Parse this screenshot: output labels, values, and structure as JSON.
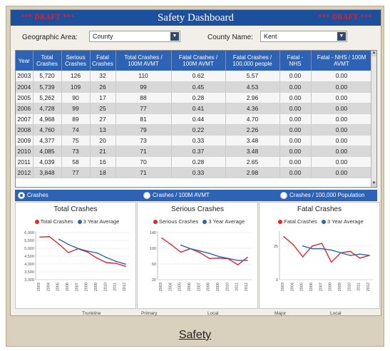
{
  "header": {
    "title": "Safety Dashboard",
    "draft_left": "*** DRAFT ***",
    "draft_right": "*** DRAFT ***"
  },
  "filters": {
    "geo_label": "Geographic Area:",
    "geo_value": "County",
    "county_label": "County Name:",
    "county_value": "Kent"
  },
  "table": {
    "columns": [
      "Year",
      "Total Crashes",
      "Serious Crashes",
      "Fatal Crashes",
      "Total Crashes / 100M AVMT",
      "Fatal Crashes / 100M AVMT",
      "Fatal Crashes / 100,000 people",
      "Fatal - NHS",
      "Fatal - NHS / 100M AVMT"
    ],
    "rows": [
      [
        "2003",
        "5,720",
        "126",
        "32",
        "110",
        "0.62",
        "5.57",
        "0.00",
        "0.00"
      ],
      [
        "2004",
        "5,739",
        "109",
        "26",
        "99",
        "0.45",
        "4.53",
        "0.00",
        "0.00"
      ],
      [
        "2005",
        "5,262",
        "90",
        "17",
        "88",
        "0.28",
        "2.96",
        "0.00",
        "0.00"
      ],
      [
        "2006",
        "4,728",
        "99",
        "25",
        "77",
        "0.41",
        "4.36",
        "0.00",
        "0.00"
      ],
      [
        "2007",
        "4,968",
        "89",
        "27",
        "81",
        "0.44",
        "4.70",
        "0.00",
        "0.00"
      ],
      [
        "2008",
        "4,760",
        "74",
        "13",
        "79",
        "0.22",
        "2.26",
        "0.00",
        "0.00"
      ],
      [
        "2009",
        "4,377",
        "75",
        "20",
        "73",
        "0.33",
        "3.48",
        "0.00",
        "0.00"
      ],
      [
        "2010",
        "4,085",
        "73",
        "21",
        "71",
        "0.37",
        "3.48",
        "0.00",
        "0.00"
      ],
      [
        "2011",
        "4,039",
        "58",
        "16",
        "70",
        "0.28",
        "2.65",
        "0.00",
        "0.00"
      ],
      [
        "2012",
        "3,848",
        "77",
        "18",
        "71",
        "0.33",
        "2.98",
        "0.00",
        "0.00"
      ]
    ]
  },
  "radios": {
    "crashes": "Crashes",
    "per_avmt": "Crashes / 100M AVMT",
    "per_pop": "Crashes / 100,000 Population",
    "selected": "crashes"
  },
  "colors": {
    "actual": "#e3262b",
    "average": "#2c67b6",
    "header_blue": "#1c4f9c",
    "draft_red": "#e0242a"
  },
  "chart_data": [
    {
      "type": "line",
      "title": "Total Crashes",
      "x": [
        "2003",
        "2004",
        "2005",
        "2006",
        "2007",
        "2008",
        "2009",
        "2010",
        "2011",
        "2012"
      ],
      "series": [
        {
          "name": "Total Crashes",
          "values": [
            5720,
            5739,
            5262,
            4728,
            4968,
            4760,
            4377,
            4085,
            4039,
            3848
          ]
        },
        {
          "name": "3 Year Average",
          "values": [
            null,
            null,
            5574,
            5243,
            4986,
            4819,
            4702,
            4407,
            4167,
            3991
          ]
        }
      ],
      "ylim": [
        3000,
        6000
      ],
      "yticks": [
        "3,000",
        "3,500",
        "4,000",
        "4,500",
        "5,000",
        "5,500",
        "6,000"
      ]
    },
    {
      "type": "line",
      "title": "Serious Crashes",
      "x": [
        "2003",
        "2004",
        "2005",
        "2006",
        "2007",
        "2008",
        "2009",
        "2010",
        "2011",
        "2012"
      ],
      "series": [
        {
          "name": "Serious Crashes",
          "values": [
            126,
            109,
            90,
            99,
            89,
            74,
            75,
            73,
            58,
            77
          ]
        },
        {
          "name": "3 Year Average",
          "values": [
            null,
            null,
            108,
            99,
            93,
            87,
            79,
            74,
            69,
            69
          ]
        }
      ],
      "ylim": [
        20,
        140
      ],
      "yticks": [
        "20",
        "60",
        "100",
        "140"
      ]
    },
    {
      "type": "line",
      "title": "Fatal Crashes",
      "x": [
        "2003",
        "2004",
        "2005",
        "2006",
        "2007",
        "2008",
        "2009",
        "2010",
        "2011",
        "2012"
      ],
      "series": [
        {
          "name": "Fatal Crashes",
          "values": [
            32,
            26,
            17,
            25,
            27,
            13,
            20,
            21,
            16,
            18
          ]
        },
        {
          "name": "3 Year Average",
          "values": [
            null,
            null,
            25,
            23,
            23,
            22,
            20,
            18,
            19,
            18
          ]
        }
      ],
      "ylim": [
        0,
        35
      ],
      "yticks": [
        "0",
        "25"
      ]
    }
  ],
  "footer": {
    "words": [
      "Trunkline",
      "Primary",
      "Local",
      "Major",
      "Local"
    ],
    "caption": "Safety"
  }
}
